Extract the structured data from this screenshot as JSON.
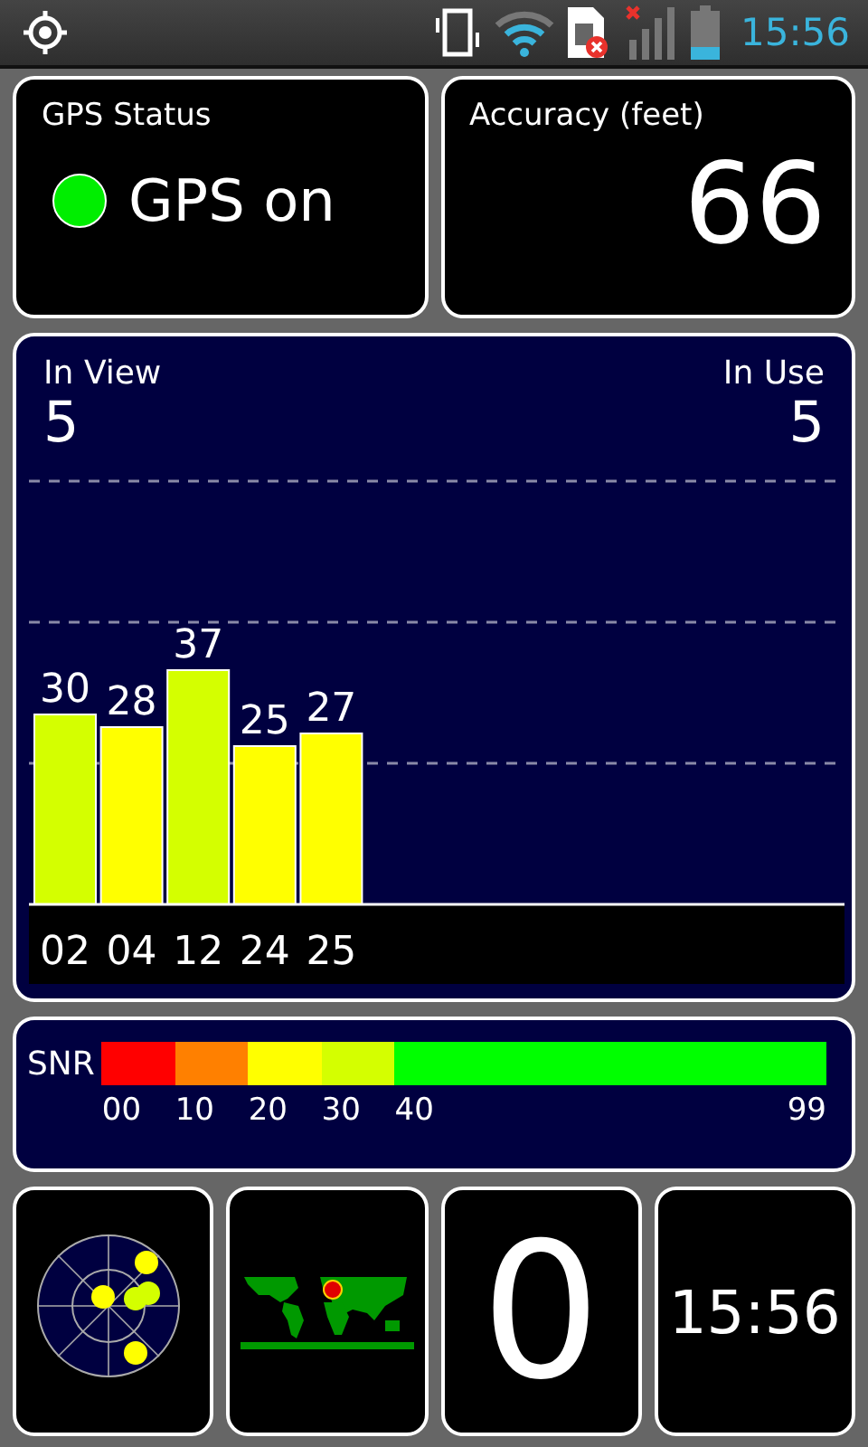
{
  "status_bar": {
    "time": "15:56"
  },
  "gps_status": {
    "title": "GPS Status",
    "label": "GPS on",
    "on": true
  },
  "accuracy": {
    "title": "Accuracy (feet)",
    "value": "66"
  },
  "satellites": {
    "in_view_label": "In View",
    "in_view": "5",
    "in_use_label": "In Use",
    "in_use": "5",
    "chart_data": {
      "type": "bar",
      "categories": [
        "02",
        "04",
        "12",
        "24",
        "25"
      ],
      "values": [
        30,
        28,
        37,
        25,
        27
      ],
      "data_labels": true
    }
  },
  "snr_legend": {
    "title": "SNR",
    "max_label": "99",
    "segments": [
      {
        "label": "00",
        "color": "#ff0000"
      },
      {
        "label": "10",
        "color": "#ff8000"
      },
      {
        "label": "20",
        "color": "#ffff00"
      },
      {
        "label": "30",
        "color": "#d4ff00"
      },
      {
        "label": "40",
        "color": "#00ff00"
      }
    ]
  },
  "tiles": [
    {
      "kind": "picture"
    },
    {
      "kind": "picture"
    },
    {
      "kind": "number",
      "value": "0"
    },
    {
      "kind": "clock",
      "value": "15:56"
    }
  ]
}
